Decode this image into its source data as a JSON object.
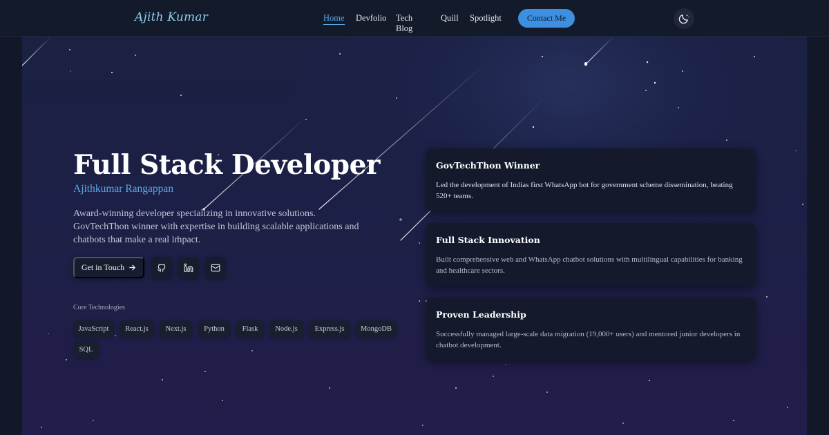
{
  "header": {
    "brand": "Ajith Kumar",
    "nav": [
      "Home",
      "Devfolio",
      "Tech Blog",
      "Quill",
      "Spotlight"
    ],
    "active_nav": "Home",
    "contact_label": "Contact Me",
    "theme_toggle_icon": "moon-icon"
  },
  "hero": {
    "title": "Full Stack Developer",
    "name": "Ajithkumar Rangappan",
    "description": "Award-winning developer specializing in innovative solutions. GovTechThon winner with expertise in building scalable applications and chatbots that make a real impact.",
    "cta_label": "Get in Touch",
    "social_icons": [
      "github-icon",
      "linkedin-icon",
      "mail-icon"
    ],
    "core_label": "Core Technologies",
    "technologies": [
      "JavaScript",
      "React.js",
      "Next.js",
      "Python",
      "Flask",
      "Node.js",
      "Express.js",
      "MongoDB",
      "SQL"
    ]
  },
  "cards": [
    {
      "title": "GovTechThon Winner",
      "text": "Led the development of Indias first WhatsApp bot for government scheme dissemination, beating 520+ teams."
    },
    {
      "title": "Full Stack Innovation",
      "text": "Built comprehensive web and WhatsApp chatbot solutions with multilingual capabilities for banking and healthcare sectors."
    },
    {
      "title": "Proven Leadership",
      "text": "Successfully managed large-scale data migration (19,000+ users) and mentored junior developers in chatbot development."
    }
  ],
  "colors": {
    "accent": "#5aa8e6",
    "button": "#3e8fe0",
    "background": "#121828",
    "card": "#141a2c"
  }
}
